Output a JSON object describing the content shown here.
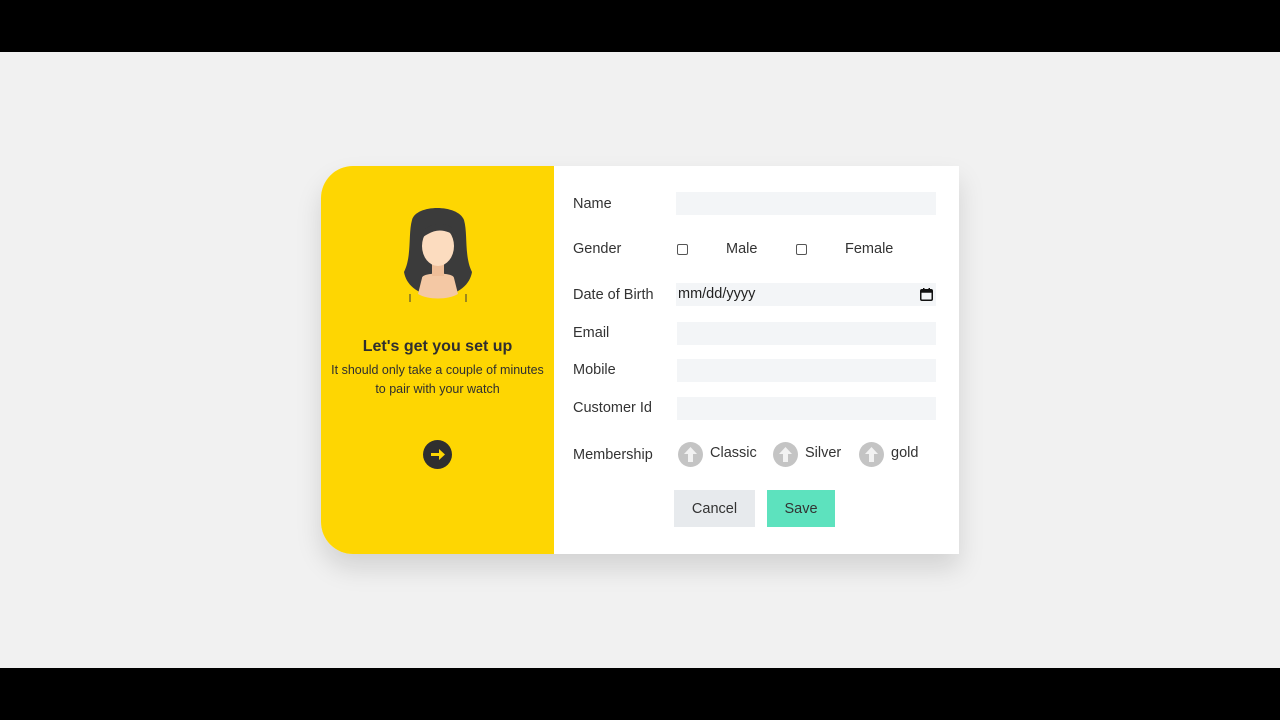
{
  "welcome": {
    "title": "Let's get you set up",
    "subtitle_line1": "It should only take a couple of minutes",
    "subtitle_line2": "to pair with your watch"
  },
  "form": {
    "name_label": "Name",
    "name_value": "",
    "gender_label": "Gender",
    "gender_options": [
      "Male",
      "Female"
    ],
    "dob_label": "Date of Birth",
    "dob_placeholder": "mm/dd/yyyy",
    "email_label": "Email",
    "email_value": "",
    "mobile_label": "Mobile",
    "mobile_value": "",
    "customer_id_label": "Customer Id",
    "customer_id_value": "",
    "membership_label": "Membership",
    "membership_options": [
      "Classic",
      "Silver",
      "gold"
    ],
    "cancel_label": "Cancel",
    "save_label": "Save"
  },
  "colors": {
    "panel_yellow": "#fed602",
    "save_green": "#5de2be",
    "cancel_gray": "#e7eaed",
    "field_bg": "#f3f5f7"
  },
  "icons": {
    "avatar": "female-avatar-icon",
    "next": "arrow-right-circle-icon",
    "calendar": "calendar-icon",
    "membership": "arrow-up-icon"
  }
}
